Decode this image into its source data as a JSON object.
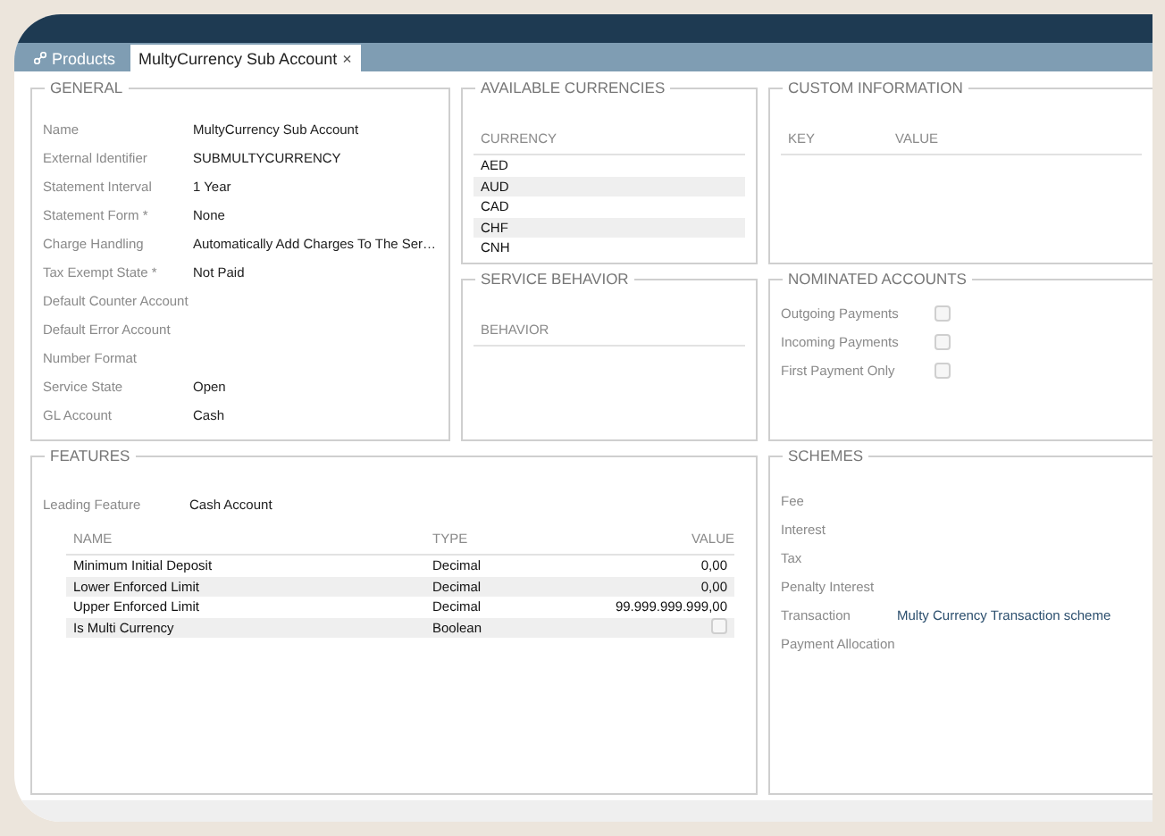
{
  "tabs": [
    {
      "label": "Products",
      "selected": false,
      "kind": "module"
    },
    {
      "label": "MultyCurrency Sub Account",
      "selected": true,
      "kind": "record",
      "close": "×"
    }
  ],
  "general": {
    "title": "GENERAL",
    "fields": [
      {
        "label": "Name",
        "value": "MultyCurrency Sub Account"
      },
      {
        "label": "External Identifier",
        "value": "SUBMULTYCURRENCY"
      },
      {
        "label": "Statement Interval",
        "value": "1 Year"
      },
      {
        "label": "Statement Form *",
        "value": "None"
      },
      {
        "label": "Charge Handling",
        "value": "Automatically Add Charges To The Ser…"
      },
      {
        "label": "Tax Exempt State *",
        "value": "Not Paid"
      },
      {
        "label": "Default Counter Account"
      },
      {
        "label": "Default Error Account"
      },
      {
        "label": "Number Format"
      },
      {
        "label": "Service State",
        "value": "Open"
      },
      {
        "label": "GL Account",
        "value": "Cash"
      }
    ]
  },
  "available_currencies": {
    "title": "AVAILABLE CURRENCIES",
    "column": "CURRENCY",
    "rows": [
      "AED",
      "AUD",
      "CAD",
      "CHF",
      "CNH"
    ]
  },
  "service_behavior": {
    "title": "SERVICE BEHAVIOR",
    "column": "BEHAVIOR"
  },
  "custom_information": {
    "title": "CUSTOM INFORMATION",
    "columns": [
      "KEY",
      "VALUE"
    ]
  },
  "nominated_accounts": {
    "title": "NOMINATED ACCOUNTS",
    "items": [
      {
        "label": "Outgoing Payments",
        "checked": false
      },
      {
        "label": "Incoming Payments",
        "checked": false
      },
      {
        "label": "First Payment Only",
        "checked": false
      }
    ]
  },
  "features": {
    "title": "FEATURES",
    "leading": {
      "label": "Leading Feature",
      "value": "Cash Account"
    },
    "columns": [
      "NAME",
      "TYPE",
      "VALUE"
    ],
    "rows": [
      {
        "kind": "text",
        "name": "Minimum Initial Deposit",
        "type": "Decimal",
        "value": "0,00"
      },
      {
        "kind": "text",
        "name": "Lower Enforced Limit",
        "type": "Decimal",
        "value": "0,00"
      },
      {
        "kind": "text",
        "name": "Upper Enforced Limit",
        "type": "Decimal",
        "value": "99.999.999.999,00"
      },
      {
        "kind": "checkbox",
        "name": "Is Multi Currency",
        "type": "Boolean",
        "checked": false
      }
    ]
  },
  "schemes": {
    "title": "SCHEMES",
    "items": [
      {
        "label": "Fee"
      },
      {
        "label": "Interest"
      },
      {
        "label": "Tax"
      },
      {
        "label": "Penalty Interest"
      },
      {
        "label": "Transaction",
        "value": "Multy Currency Transaction scheme"
      },
      {
        "label": "Payment Allocation"
      }
    ]
  }
}
